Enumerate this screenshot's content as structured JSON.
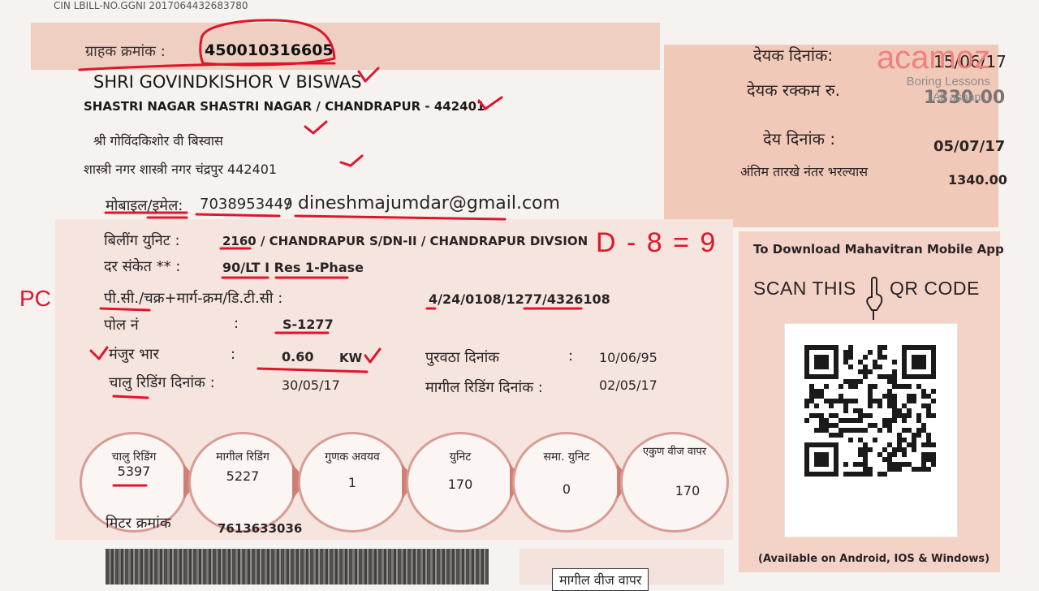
{
  "header": {
    "cin": "CIN  LBILL-NO.GGNI 2017064432683780"
  },
  "consumer": {
    "label": "ग्राहक क्रमांक :",
    "number": "450010316605",
    "name": "SHRI GOVINDKISHOR V BISWAS",
    "address_en": "SHASTRI NAGAR SHASTRI NAGAR / CHANDRAPUR - 442401",
    "name_mr": "श्री गोविंदकिशोर वी बिस्वास",
    "address_mr": "शास्त्री नगर शास्त्री नगर    चंद्रपुर    442401",
    "contact_label": "मोबाइल/इमेल:",
    "mobile": "7038953449",
    "email": "dineshmajumdar@gmail.com"
  },
  "due": {
    "date_label": "देयक दिनांक:",
    "date_value": "15/06/17",
    "amount_label": "देयक रक्कम रु.",
    "amount_value": "1330.00",
    "pay_label": "देय दिनांक :",
    "pay_value": "05/07/17",
    "late_label": "अंतिम तारखे नंतर भरल्यास",
    "late_value": "1340.00"
  },
  "details": {
    "billing_unit_label": "बिलींग युनिट   :",
    "billing_unit_value": "2160 / CHANDRAPUR S/DN-II / CHANDRAPUR DIVSION",
    "tariff_label": "दर संकेत **   :",
    "tariff_value": "90/LT I Res 1-Phase",
    "pc_label": "पी.सी./चक्र+मार्ग-क्रम/डि.टी.सी :",
    "pc_value": "4/24/0108/1277/4326108",
    "pole_label": "पोल नं",
    "pole_value": "S-1277",
    "load_label": "मंजुर भार",
    "load_value": "0.60",
    "load_unit": "KW",
    "supply_label": "पुरवठा दिनांक",
    "supply_value": "10/06/95",
    "current_label": "चालु रिडिंग दिनांक :",
    "current_value": "30/05/17",
    "previous_label": "मागील रिडिंग दिनांक :",
    "previous_value": "02/05/17",
    "colon": ":"
  },
  "readings": [
    {
      "label": "चालु रिडिंग",
      "value": "5397"
    },
    {
      "label": "मागील रिडिंग",
      "value": "5227"
    },
    {
      "label": "गुणक अवयव",
      "value": "1"
    },
    {
      "label": "युनिट",
      "value": "170"
    },
    {
      "label": "समा. युनिट",
      "value": "0"
    },
    {
      "label": "एकुण वीज वापर",
      "value": "170"
    }
  ],
  "meter": {
    "label": "मिटर क्रमांक",
    "value": "7613633036"
  },
  "qr": {
    "download_text": "To Download Mahavitran Mobile App",
    "scan_text": "SCAN THIS",
    "scan_text_end": "QR CODE",
    "available_text": "(Available on Android, IOS & Windows)"
  },
  "footer": {
    "previous_usage": "मागील वीज वापर"
  },
  "annotations": {
    "pc": "PC",
    "formula": "D - 8 = 9",
    "ink_color": "#e0142b"
  },
  "watermark": {
    "brand": "acamoz",
    "tagline1": "Boring Lessons",
    "tagline2": "Ab asaan..."
  }
}
